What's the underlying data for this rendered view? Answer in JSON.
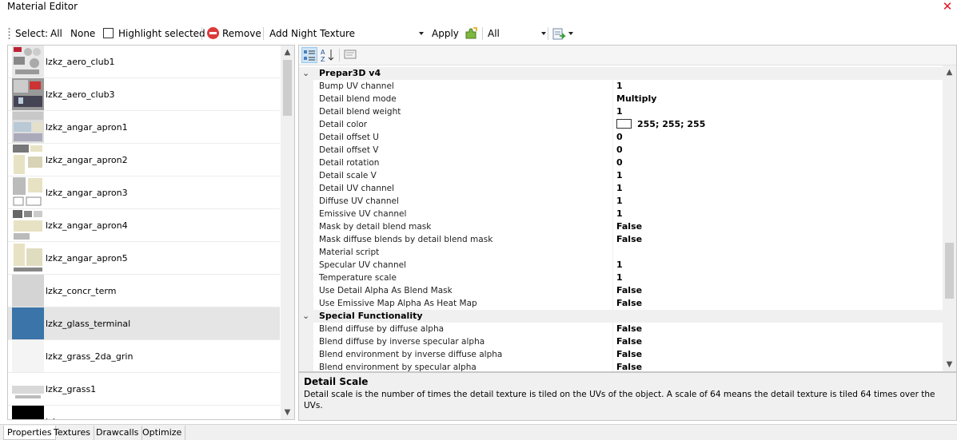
{
  "window": {
    "title": "Material Editor"
  },
  "toolbar": {
    "select_label": "Select:",
    "all_label": "All",
    "none_label": "None",
    "highlight_label": "Highlight selected",
    "highlight_checked": false,
    "remove_label": "Remove",
    "add_night_texture_label": "Add Night Texture",
    "apply_label": "Apply",
    "filter_value": "All"
  },
  "materials": [
    {
      "name": "lzkz_aero_club1"
    },
    {
      "name": "lzkz_aero_club3"
    },
    {
      "name": "lzkz_angar_apron1"
    },
    {
      "name": "lzkz_angar_apron2"
    },
    {
      "name": "lzkz_angar_apron3"
    },
    {
      "name": "lzkz_angar_apron4"
    },
    {
      "name": "lzkz_angar_apron5"
    },
    {
      "name": "lzkz_concr_term"
    },
    {
      "name": "lzkz_glass_terminal",
      "selected": true
    },
    {
      "name": "lzkz_grass_2da_grin"
    },
    {
      "name": "lzkz_grass1"
    },
    {
      "name": "lzkz_..."
    }
  ],
  "properties": {
    "categories": [
      {
        "name": "Prepar3D v4",
        "rows": [
          {
            "name": "Bump UV channel",
            "value": "1"
          },
          {
            "name": "Detail blend mode",
            "value": "Multiply"
          },
          {
            "name": "Detail blend weight",
            "value": "1"
          },
          {
            "name": "Detail color",
            "value": "255; 255; 255",
            "swatch": "#ffffff"
          },
          {
            "name": "Detail offset U",
            "value": "0"
          },
          {
            "name": "Detail offset V",
            "value": "0"
          },
          {
            "name": "Detail rotation",
            "value": "0"
          },
          {
            "name": "Detail scale V",
            "value": "1"
          },
          {
            "name": "Detail UV channel",
            "value": "1"
          },
          {
            "name": "Diffuse UV channel",
            "value": "1"
          },
          {
            "name": "Emissive UV channel",
            "value": "1"
          },
          {
            "name": "Mask by detail blend mask",
            "value": "False"
          },
          {
            "name": "Mask diffuse blends by detail blend mask",
            "value": "False"
          },
          {
            "name": "Material script",
            "value": ""
          },
          {
            "name": "Specular UV channel",
            "value": "1"
          },
          {
            "name": "Temperature scale",
            "value": "1"
          },
          {
            "name": "Use Detail Alpha As Blend Mask",
            "value": "False"
          },
          {
            "name": "Use Emissive Map Alpha As Heat Map",
            "value": "False"
          }
        ]
      },
      {
        "name": "Special Functionality",
        "rows": [
          {
            "name": "Blend diffuse by diffuse alpha",
            "value": "False"
          },
          {
            "name": "Blend diffuse by inverse specular alpha",
            "value": "False"
          },
          {
            "name": "Blend environment by inverse diffuse alpha",
            "value": "False"
          },
          {
            "name": "Blend environment by specular alpha",
            "value": "False"
          }
        ]
      }
    ]
  },
  "description": {
    "title": "Detail Scale",
    "text": "Detail scale is the number of times the detail texture is tiled on the UVs of the object. A scale of 64 means the detail texture is tiled 64 times over the UVs."
  },
  "tabs": [
    "Properties",
    "Textures",
    "Drawcalls",
    "Optimize"
  ],
  "active_tab": "Properties"
}
